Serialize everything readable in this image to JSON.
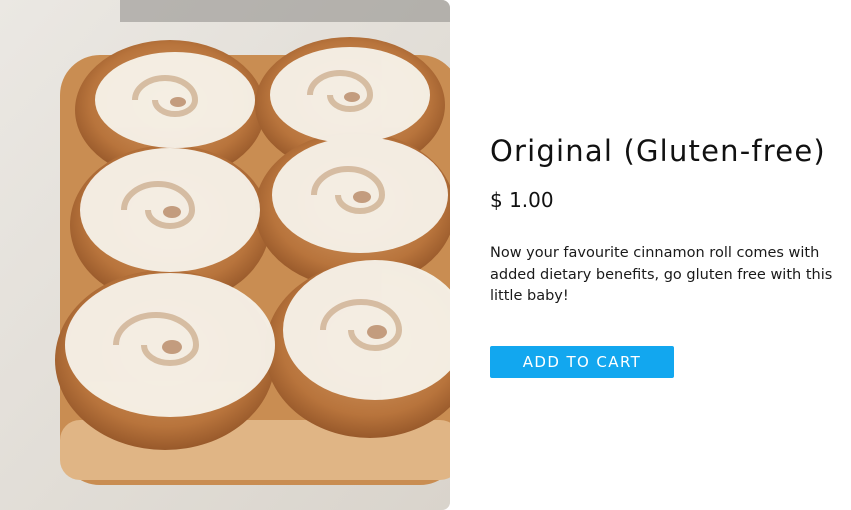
{
  "product": {
    "image_alt": "cinnamon-rolls-photo",
    "title": "Original (Gluten-free)",
    "price": "$ 1.00",
    "description": "Now your favourite cinnamon roll comes with added dietary benefits, go gluten free with this little baby!",
    "add_to_cart_label": "ADD TO CART"
  },
  "colors": {
    "accent": "#12a7ef",
    "text": "#111111",
    "background": "#ffffff"
  }
}
